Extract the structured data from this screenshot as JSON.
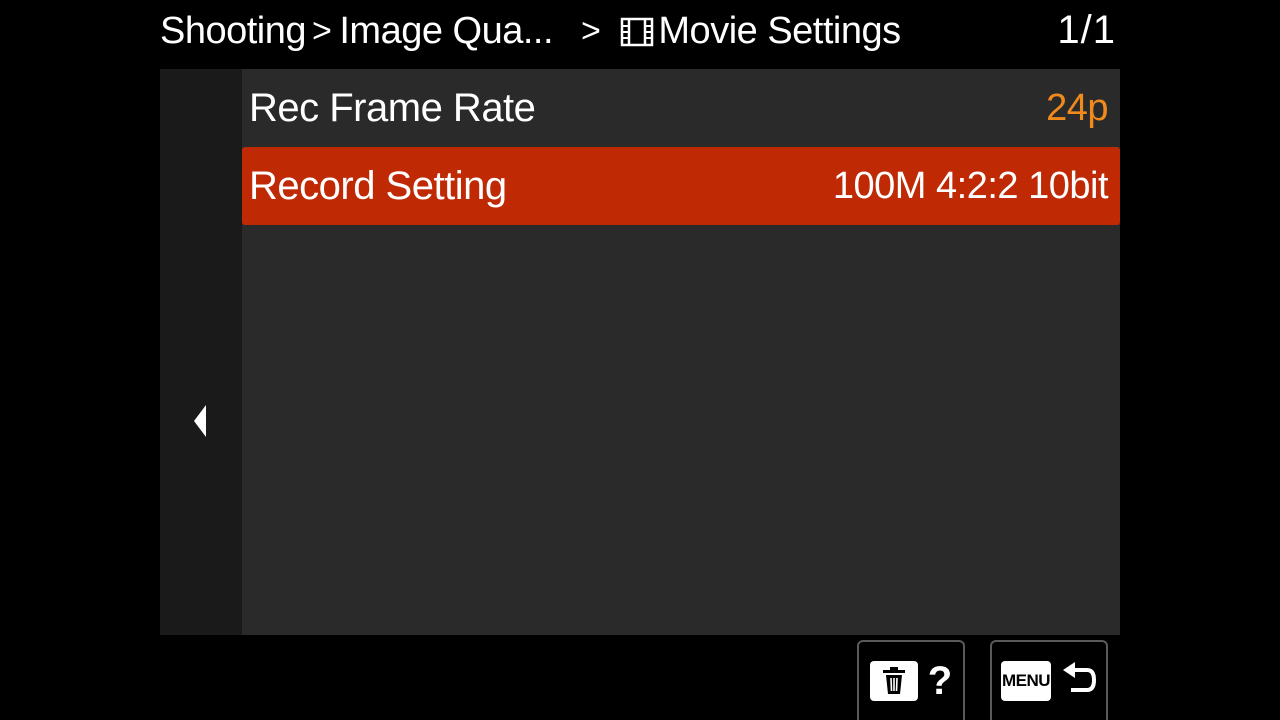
{
  "breadcrumb": {
    "level1": "Shooting",
    "separator": ">",
    "level2": "Image Qua...",
    "separator2": ">",
    "current_icon": "film-icon",
    "current": "Movie Settings"
  },
  "page_indicator": "1/1",
  "menu": {
    "items": [
      {
        "label": "Rec Frame Rate",
        "value": "24p",
        "value_color": "#f08a1c",
        "selected": false
      },
      {
        "label": "Record Setting",
        "value": "100M 4:2:2 10bit",
        "value_color": "#ffffff",
        "selected": true
      }
    ]
  },
  "icons": {
    "back": "left-triangle-icon",
    "delete": "trash-icon",
    "return": "return-arrow-icon"
  },
  "buttons": {
    "help_symbol": "?",
    "menu_label": "MENU"
  },
  "colors": {
    "selected_row": "#bf2a05",
    "panel": "#2a2a2a",
    "accent_value": "#f08a1c"
  }
}
